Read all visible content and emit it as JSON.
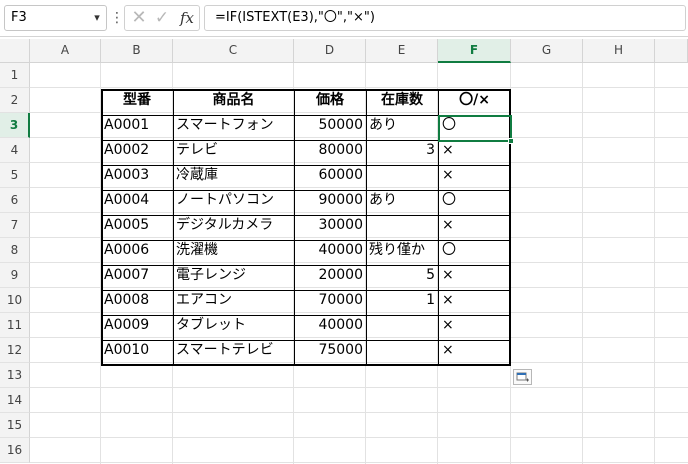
{
  "formula_bar": {
    "name_box": "F3",
    "cancel_icon": "✕",
    "enter_icon": "✓",
    "fx_label": "fx",
    "formula": "=IF(ISTEXT(E3),\"〇\",\"×\")"
  },
  "columns": [
    "A",
    "B",
    "C",
    "D",
    "E",
    "F",
    "G",
    "H"
  ],
  "rows": [
    "1",
    "2",
    "3",
    "4",
    "5",
    "6",
    "7",
    "8",
    "9",
    "10",
    "11",
    "12",
    "13",
    "14",
    "15",
    "16"
  ],
  "selected_cell": "F3",
  "table": {
    "headers": [
      "型番",
      "商品名",
      "価格",
      "在庫数",
      "〇/×"
    ],
    "rows": [
      {
        "model": "A0001",
        "name": "スマートフォン",
        "price": "50000",
        "stock": "あり",
        "mark": "〇"
      },
      {
        "model": "A0002",
        "name": "テレビ",
        "price": "80000",
        "stock": "3",
        "mark": "×"
      },
      {
        "model": "A0003",
        "name": "冷蔵庫",
        "price": "60000",
        "stock": "",
        "mark": "×"
      },
      {
        "model": "A0004",
        "name": "ノートパソコン",
        "price": "90000",
        "stock": "あり",
        "mark": "〇"
      },
      {
        "model": "A0005",
        "name": "デジタルカメラ",
        "price": "30000",
        "stock": "",
        "mark": "×"
      },
      {
        "model": "A0006",
        "name": "洗濯機",
        "price": "40000",
        "stock": "残り僅か",
        "mark": "〇"
      },
      {
        "model": "A0007",
        "name": "電子レンジ",
        "price": "20000",
        "stock": "5",
        "mark": "×"
      },
      {
        "model": "A0008",
        "name": "エアコン",
        "price": "70000",
        "stock": "1",
        "mark": "×"
      },
      {
        "model": "A0009",
        "name": "タブレット",
        "price": "40000",
        "stock": "",
        "mark": "×"
      },
      {
        "model": "A0010",
        "name": "スマートテレビ",
        "price": "75000",
        "stock": "",
        "mark": "×"
      }
    ]
  },
  "colors": {
    "accent": "#107c41",
    "header_bg": "#f3f3f3",
    "gridline": "#e2e2e2"
  },
  "icons": {
    "paste_options": "paste-options-icon"
  }
}
